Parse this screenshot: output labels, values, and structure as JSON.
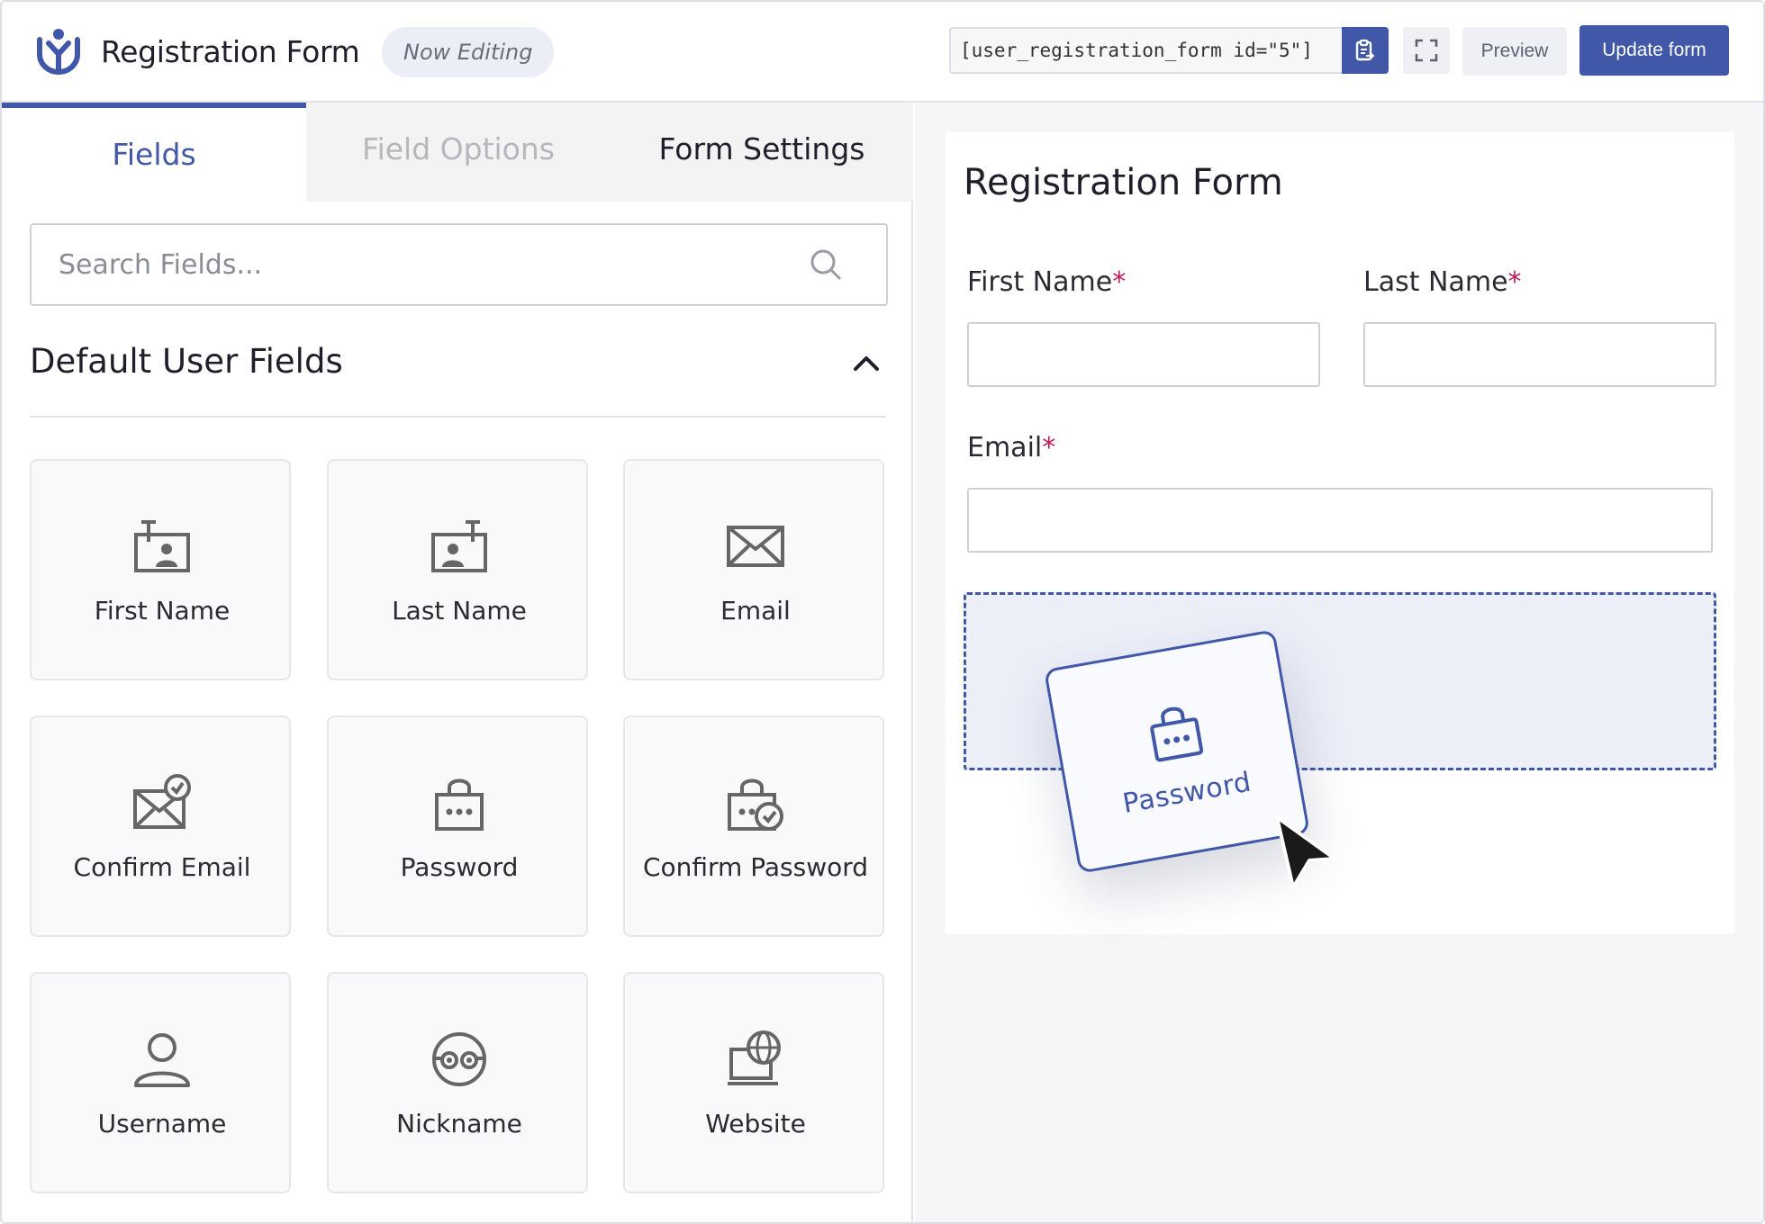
{
  "header": {
    "title": "Registration Form",
    "status_badge": "Now Editing",
    "shortcode": "[user_registration_form id=\"5\"]",
    "preview_label": "Preview",
    "update_label": "Update form"
  },
  "tabs": [
    {
      "label": "Fields",
      "active": true
    },
    {
      "label": "Field Options",
      "active": false
    },
    {
      "label": "Form Settings",
      "active": false
    }
  ],
  "search": {
    "placeholder": "Search Fields..."
  },
  "section": {
    "title": "Default User Fields"
  },
  "fields": [
    {
      "label": "First Name",
      "icon": "first-name-icon"
    },
    {
      "label": "Last Name",
      "icon": "last-name-icon"
    },
    {
      "label": "Email",
      "icon": "email-icon"
    },
    {
      "label": "Confirm Email",
      "icon": "confirm-email-icon"
    },
    {
      "label": "Password",
      "icon": "password-icon"
    },
    {
      "label": "Confirm Password",
      "icon": "confirm-password-icon"
    },
    {
      "label": "Username",
      "icon": "user-icon"
    },
    {
      "label": "Nickname",
      "icon": "nickname-icon"
    },
    {
      "label": "Website",
      "icon": "website-icon"
    }
  ],
  "form": {
    "title": "Registration Form",
    "first_name_label": "First Name",
    "last_name_label": "Last Name",
    "email_label": "Email",
    "required_mark": "*"
  },
  "drag": {
    "label": "Password",
    "icon": "password-icon"
  },
  "colors": {
    "accent": "#4157a8",
    "required": "#c2185b",
    "dropzone": "#eceef8"
  }
}
